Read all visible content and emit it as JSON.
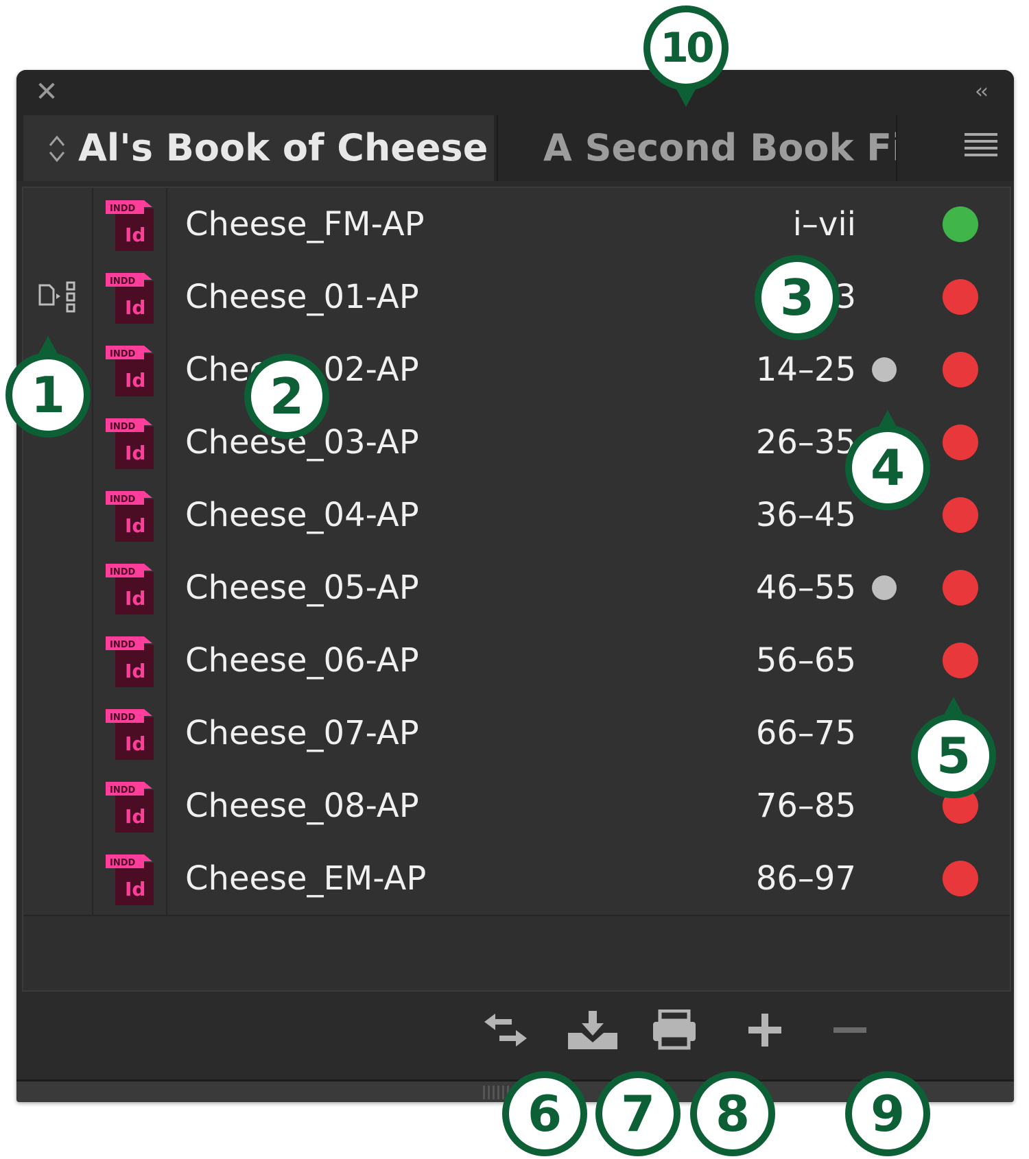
{
  "panel": {
    "tabs": [
      {
        "label": "Al's Book of Cheese",
        "active": true
      },
      {
        "label": "A Second Book File",
        "active": false
      }
    ]
  },
  "documents": [
    {
      "name": "Cheese_FM-AP",
      "pages": "i–vii",
      "status_color": "#3fb54a",
      "modified": false,
      "sync_source": false
    },
    {
      "name": "Cheese_01-AP",
      "pages": "1–13",
      "status_color": "#e8383c",
      "modified": false,
      "sync_source": true
    },
    {
      "name": "Cheese_02-AP",
      "pages": "14–25",
      "status_color": "#e8383c",
      "modified": true,
      "sync_source": false
    },
    {
      "name": "Cheese_03-AP",
      "pages": "26–35",
      "status_color": "#e8383c",
      "modified": false,
      "sync_source": false
    },
    {
      "name": "Cheese_04-AP",
      "pages": "36–45",
      "status_color": "#e8383c",
      "modified": false,
      "sync_source": false
    },
    {
      "name": "Cheese_05-AP",
      "pages": "46–55",
      "status_color": "#e8383c",
      "modified": true,
      "sync_source": false
    },
    {
      "name": "Cheese_06-AP",
      "pages": "56–65",
      "status_color": "#e8383c",
      "modified": false,
      "sync_source": false
    },
    {
      "name": "Cheese_07-AP",
      "pages": "66–75",
      "status_color": "#e8383c",
      "modified": false,
      "sync_source": false
    },
    {
      "name": "Cheese_08-AP",
      "pages": "76–85",
      "status_color": "#e8383c",
      "modified": false,
      "sync_source": false
    },
    {
      "name": "Cheese_EM-AP",
      "pages": "86–97",
      "status_color": "#e8383c",
      "modified": false,
      "sync_source": false
    }
  ],
  "icon_label": "INDD",
  "icon_glyph": "Id",
  "callouts": [
    "1",
    "2",
    "3",
    "4",
    "5",
    "6",
    "7",
    "8",
    "9",
    "10"
  ],
  "colors": {
    "accent": "#0d5f36",
    "indesign_pink": "#ff3d9b",
    "panel_bg": "#2b2b2b"
  }
}
